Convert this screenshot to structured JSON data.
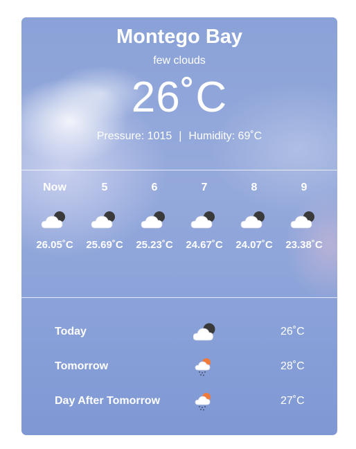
{
  "current": {
    "city": "Montego Bay",
    "description": "few clouds",
    "temperature": "26˚C",
    "pressure_text": "Pressure: 1015",
    "separator": "|",
    "humidity_text": "Humidity: 69˚C"
  },
  "hourly": [
    {
      "label": "Now",
      "temp": "26.05˚C",
      "icon": "few-clouds-night-icon"
    },
    {
      "label": "5",
      "temp": "25.69˚C",
      "icon": "few-clouds-night-icon"
    },
    {
      "label": "6",
      "temp": "25.23˚C",
      "icon": "few-clouds-night-icon"
    },
    {
      "label": "7",
      "temp": "24.67˚C",
      "icon": "few-clouds-night-icon"
    },
    {
      "label": "8",
      "temp": "24.07˚C",
      "icon": "few-clouds-night-icon"
    },
    {
      "label": "9",
      "temp": "23.38˚C",
      "icon": "few-clouds-night-icon"
    }
  ],
  "daily": [
    {
      "label": "Today",
      "temp": "26˚C",
      "icon": "few-clouds-night-icon"
    },
    {
      "label": "Tomorrow",
      "temp": "28˚C",
      "icon": "rain-sun-icon"
    },
    {
      "label": "Day After Tomorrow",
      "temp": "27˚C",
      "icon": "rain-sun-icon"
    }
  ],
  "colors": {
    "card_background": "#8ea5da",
    "text": "#ffffff",
    "moon": "#3a3a3a",
    "sun": "#f07a3a"
  }
}
